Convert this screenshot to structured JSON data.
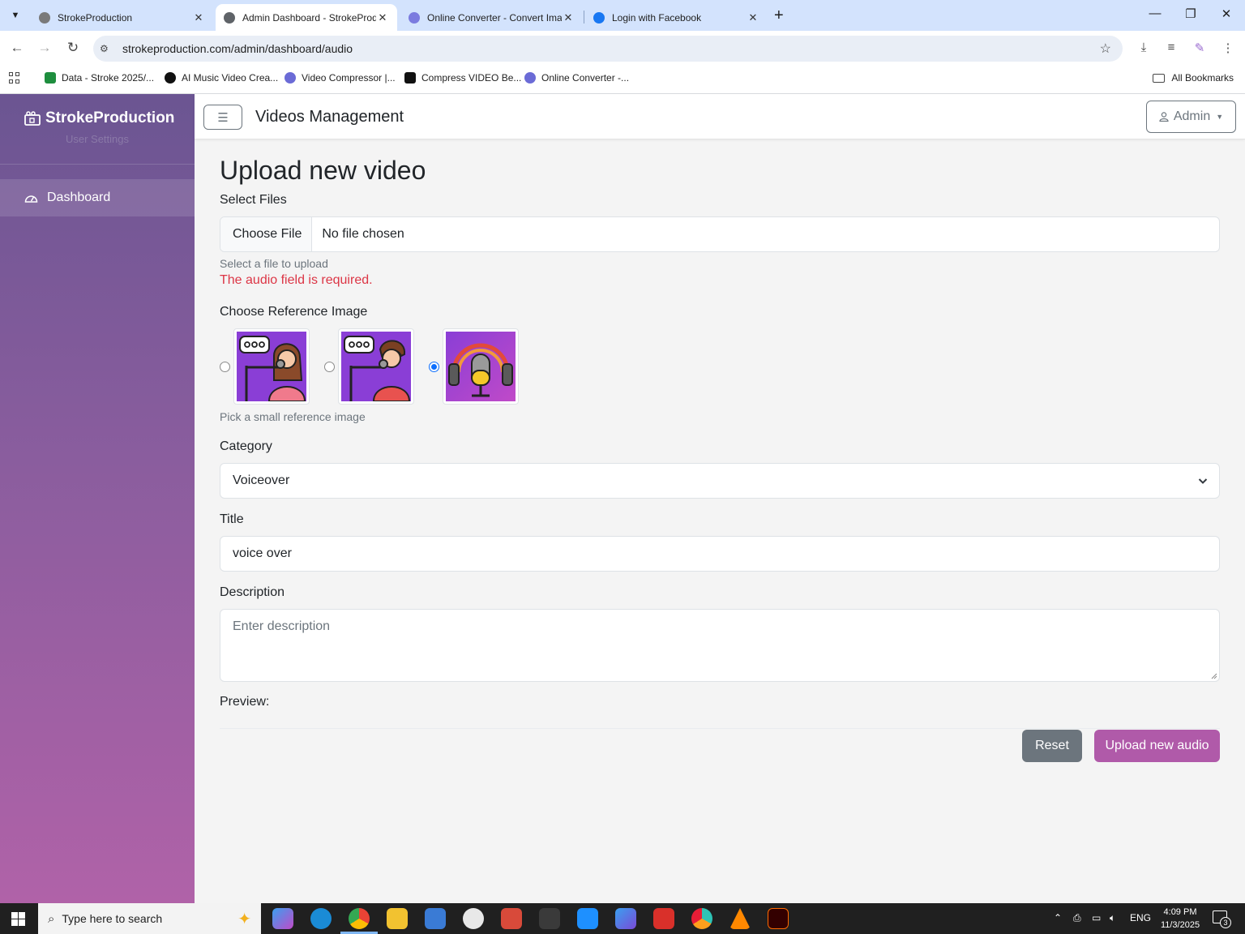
{
  "browser": {
    "tabs": [
      {
        "title": "StrokeProduction",
        "active": false
      },
      {
        "title": "Admin Dashboard - StrokeProd",
        "active": true
      },
      {
        "title": "Online Converter - Convert Ima",
        "active": false
      },
      {
        "title": "Login with Facebook",
        "active": false
      }
    ],
    "url": "strokeproduction.com/admin/dashboard/audio",
    "bookmarks": [
      {
        "label": "Data - Stroke 2025/...",
        "color": "#1e8e3e"
      },
      {
        "label": "AI Music Video Crea...",
        "color": "#111111"
      },
      {
        "label": "Video Compressor |...",
        "color": "#6b6bd6"
      },
      {
        "label": "Compress VIDEO Be...",
        "color": "#111111"
      },
      {
        "label": "Online Converter -...",
        "color": "#6b6bd6"
      }
    ],
    "all_bookmarks": "All Bookmarks"
  },
  "sidebar": {
    "brand": "StrokeProduction",
    "subtitle": "User Settings",
    "items": [
      {
        "label": "Dashboard",
        "active": true
      }
    ]
  },
  "header": {
    "title": "Videos Management",
    "user_label": "Admin"
  },
  "form": {
    "page_title": "Upload new video",
    "files": {
      "label": "Select Files",
      "button": "Choose File",
      "status": "No file chosen",
      "help": "Select a file to upload",
      "error": "The audio field is required."
    },
    "reference": {
      "label": "Choose Reference Image",
      "help": "Pick a small reference image",
      "selected_index": 2
    },
    "category": {
      "label": "Category",
      "value": "Voiceover"
    },
    "title_field": {
      "label": "Title",
      "value": "voice over"
    },
    "description": {
      "label": "Description",
      "placeholder": "Enter description"
    },
    "preview_label": "Preview:",
    "reset_button": "Reset",
    "submit_button": "Upload new audio"
  },
  "taskbar": {
    "search_placeholder": "Type here to search",
    "language": "ENG",
    "time": "4:09 PM",
    "date": "11/3/2025",
    "notification_count": "3"
  },
  "colors": {
    "accent": "#b05aa9",
    "secondary": "#6c757d",
    "error": "#dc3545",
    "sidebar_top": "#6b5592",
    "sidebar_bottom": "#b062a8"
  }
}
